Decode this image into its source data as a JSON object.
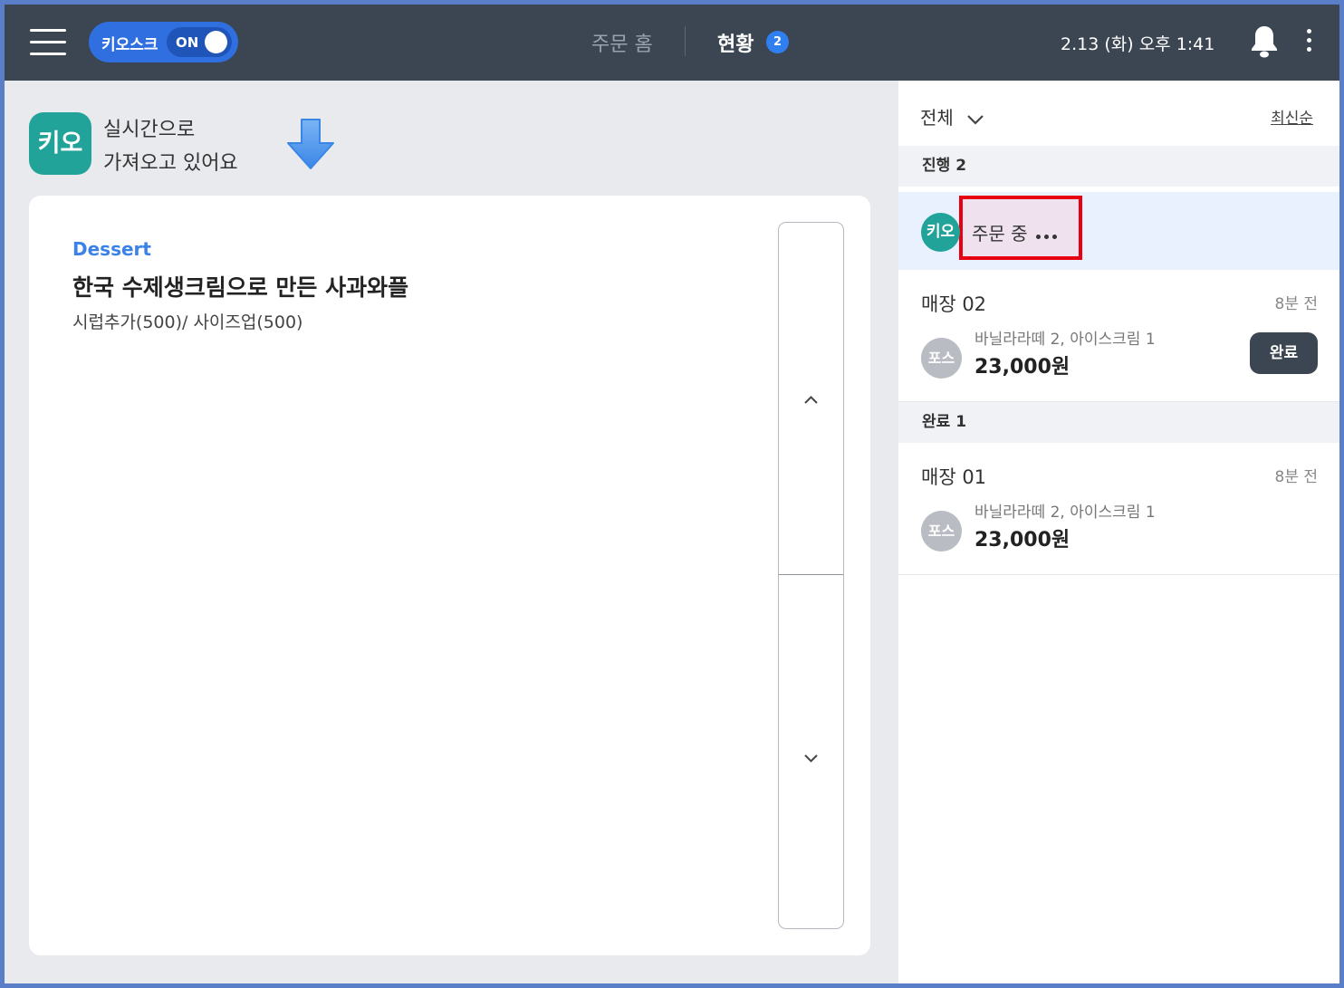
{
  "header": {
    "kiosk_label": "키오스크",
    "kiosk_toggle": "ON",
    "nav_home": "주문 홈",
    "nav_status": "현황",
    "nav_status_badge": "2",
    "datetime": "2.13 (화) 오후 1:41",
    "icons": [
      "hamburger-menu-icon",
      "bell-icon",
      "more-vertical-icon"
    ]
  },
  "left": {
    "banner": {
      "logo": "키오",
      "line1": "실시간으로",
      "line2": "가져오고 있어요",
      "icon": "arrow-down-icon"
    },
    "card": {
      "category": "Dessert",
      "product": "한국 수제생크림으로 만든 사과와플",
      "options": "시럽추가(500)/ 사이즈업(500)"
    }
  },
  "right": {
    "filter": "전체",
    "sort": "최신순",
    "sections": {
      "in_progress": "진행 2",
      "done": "완료 1"
    },
    "active_order": {
      "avatar": "키오",
      "status": "주문 중"
    },
    "orders": [
      {
        "title": "매장 02",
        "time": "8분 전",
        "avatar": "포스",
        "menu": "바닐라라떼 2, 아이스크림 1",
        "price": "23,000원",
        "action": "완료"
      },
      {
        "title": "매장 01",
        "time": "8분 전",
        "avatar": "포스",
        "menu": "바닐라라떼 2, 아이스크림 1",
        "price": "23,000원"
      }
    ]
  },
  "colors": {
    "header_bg": "#3c4652",
    "accent_blue": "#2f6fe0",
    "kio_teal": "#22a39a",
    "highlight_red": "#e60012"
  }
}
